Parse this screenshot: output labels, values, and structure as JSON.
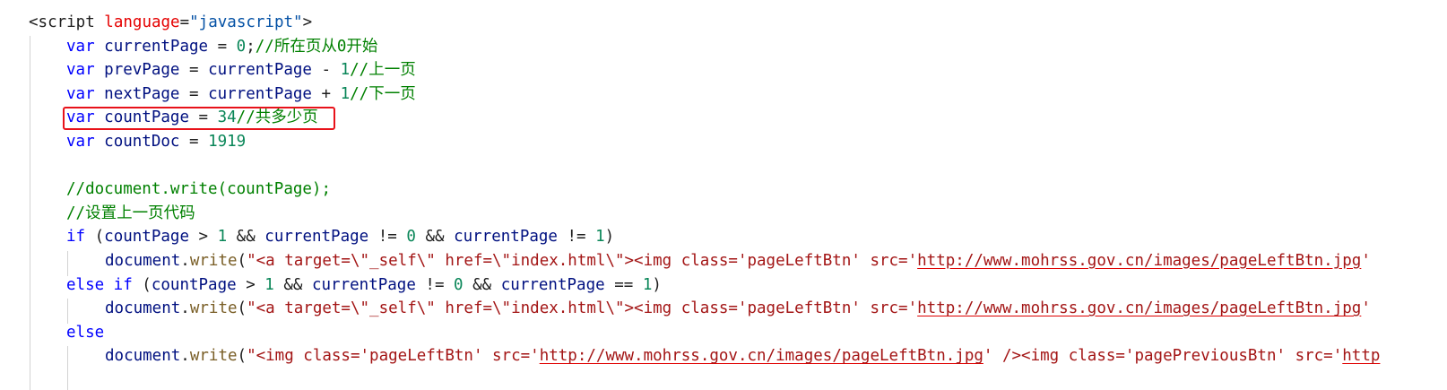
{
  "code": {
    "l1": {
      "tag_open": "<script ",
      "attr": "language",
      "eq": "=",
      "val": "\"javascript\"",
      "tag_close": ">"
    },
    "l2": {
      "kw": "var",
      "id": "currentPage",
      "op": " = ",
      "num": "0",
      "semi": ";",
      "cmt": "//所在页从0开始"
    },
    "l3": {
      "kw": "var",
      "id": "prevPage",
      "op1": " = ",
      "id2": "currentPage",
      "op2": " - ",
      "num": "1",
      "cmt": "//上一页"
    },
    "l4": {
      "kw": "var",
      "id": "nextPage",
      "op1": " = ",
      "id2": "currentPage",
      "op2": " + ",
      "num": "1",
      "cmt": "//下一页"
    },
    "l5": {
      "kw": "var",
      "id": "countPage",
      "op": " = ",
      "num": "34",
      "cmt": "//共多少页"
    },
    "l6": {
      "kw": "var",
      "id": "countDoc",
      "op": " = ",
      "num": "1919"
    },
    "l8": {
      "cmt": "//document.write(countPage);"
    },
    "l9": {
      "cmt": "//设置上一页代码"
    },
    "l10": {
      "kw": "if",
      "p1": " (",
      "id1": "countPage",
      "o1": " > ",
      "n1": "1",
      "o2": " && ",
      "id2": "currentPage",
      "o3": " != ",
      "n2": "0",
      "o4": " && ",
      "id3": "currentPage",
      "o5": " != ",
      "n3": "1",
      "p2": ")"
    },
    "l11": {
      "obj": "document",
      "dot": ".",
      "fn": "write",
      "paren": "(",
      "str": "\"<a target=\\\"_self\\\" href=\\\"index.html\\\"><img class='pageLeftBtn' src='",
      "url": "http://www.mohrss.gov.cn/images/pageLeftBtn.jpg",
      "tail": "'"
    },
    "l12": {
      "kw": "else if",
      "p1": " (",
      "id1": "countPage",
      "o1": " > ",
      "n1": "1",
      "o2": " && ",
      "id2": "currentPage",
      "o3": " != ",
      "n2": "0",
      "o4": " && ",
      "id3": "currentPage",
      "o5": " == ",
      "n3": "1",
      "p2": ")"
    },
    "l13": {
      "obj": "document",
      "dot": ".",
      "fn": "write",
      "paren": "(",
      "str": "\"<a target=\\\"_self\\\" href=\\\"index.html\\\"><img class='pageLeftBtn' src='",
      "url": "http://www.mohrss.gov.cn/images/pageLeftBtn.jpg",
      "tail": "'"
    },
    "l14": {
      "kw": "else"
    },
    "l15": {
      "obj": "document",
      "dot": ".",
      "fn": "write",
      "paren": "(",
      "str": "\"<img class='pageLeftBtn' src='",
      "url": "http://www.mohrss.gov.cn/images/pageLeftBtn.jpg",
      "str2": "' /><img class='pagePreviousBtn' src='",
      "url2": "http"
    }
  },
  "colors": {
    "keyword": "#0000ff",
    "identifier": "#001080",
    "number": "#098658",
    "comment": "#008000",
    "string": "#a31515",
    "attribute": "#e50000",
    "highlight_box": "#e8121a"
  }
}
